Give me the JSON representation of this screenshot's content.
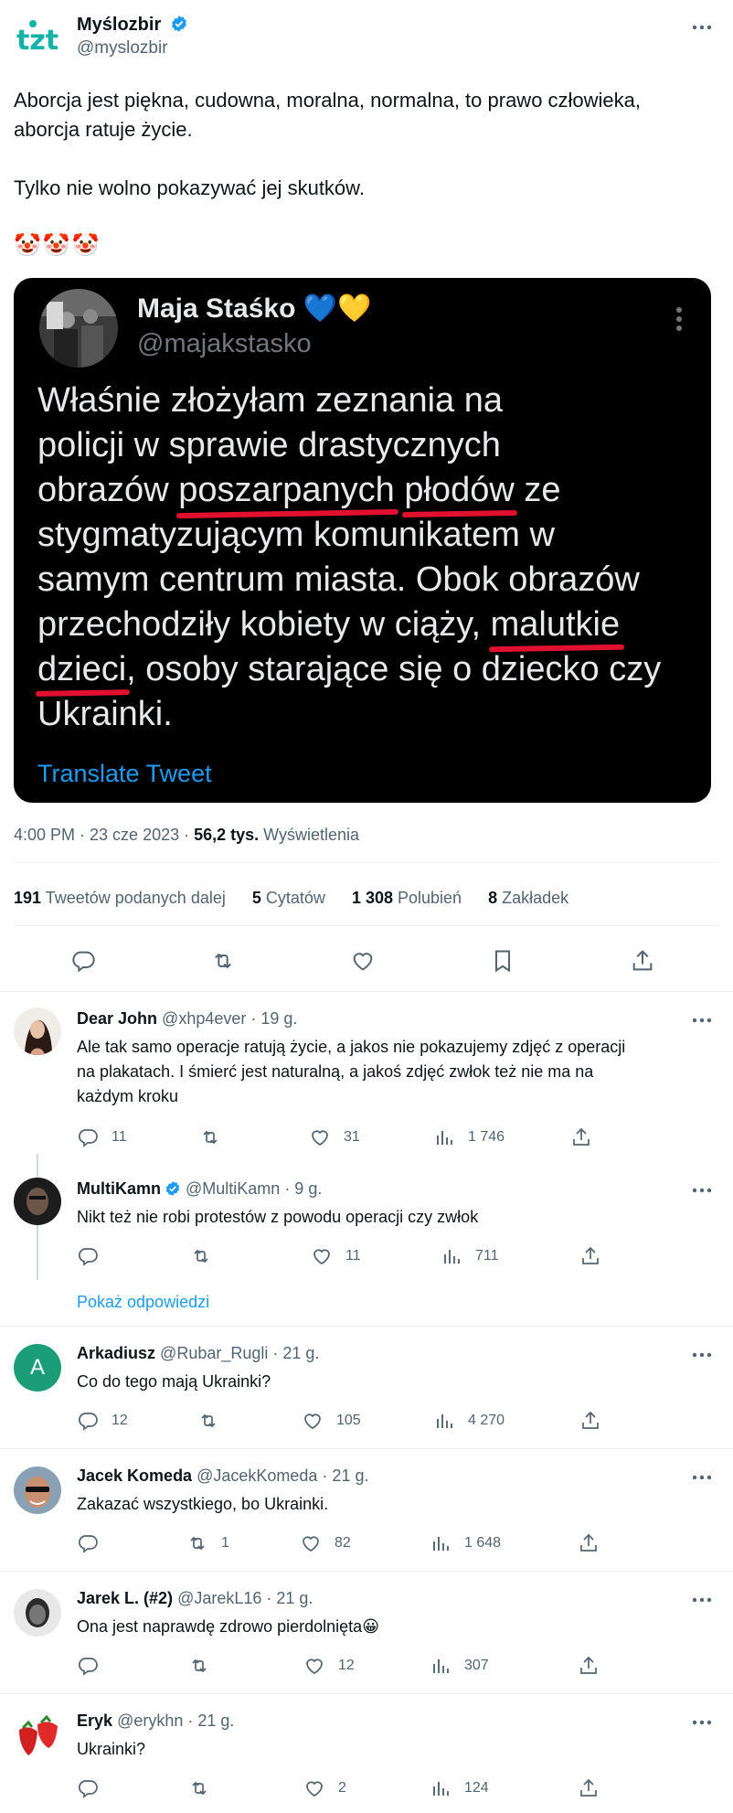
{
  "main_tweet": {
    "author_name": "Myślozbir",
    "handle": "@myslozbir",
    "logo_text": "tzt",
    "text_lines": [
      "Aborcja jest piękna, cudowna, moralna, normalna, to prawo człowieka,",
      "aborcja ratuje życie."
    ],
    "text_line2": "Tylko nie wolno pokazywać jej skutków.",
    "emoji": "🤡🤡🤡",
    "quoted": {
      "name": "Maja Staśko",
      "name_emoji": "💙💛",
      "handle": "@majakstasko",
      "body_lines": [
        [
          "Właśnie złożyłam zeznania na"
        ],
        [
          "policji w sprawie drastycznych"
        ],
        [
          "obrazów ",
          "poszarpanych",
          " ",
          "płodów",
          " ze"
        ],
        [
          "stygmatyzującym komunikatem w"
        ],
        [
          "samym centrum miasta. Obok obrazów"
        ],
        [
          "przechodziły kobiety w ciąży, ",
          "malutkie"
        ],
        [
          "dzieci",
          ", osoby starające się o dziecko czy"
        ],
        [
          "Ukrainki."
        ]
      ],
      "translate": "Translate Tweet"
    },
    "time": "4:00 PM · 23 cze 2023 · ",
    "views_count": "56,2 tys.",
    "views_label": " Wyświetlenia",
    "stats": {
      "retweets_count": "191",
      "retweets_label": " Tweetów podanych dalej",
      "quotes_count": "5",
      "quotes_label": " Cytatów",
      "likes_count": "1 308",
      "likes_label": " Polubień",
      "bookmarks_count": "8",
      "bookmarks_label": " Zakładek"
    }
  },
  "replies": [
    {
      "name": "Dear John",
      "handle": "@xhp4ever · 19 g.",
      "lines": [
        "Ale tak samo operacje ratują życie, a jakos nie pokazujemy zdjęć z operacji",
        "na plakatach. I śmierć jest naturalną, a jakoś zdjęć zwłok też nie ma na",
        "każdym kroku"
      ],
      "replies": "11",
      "retweets": "",
      "likes": "31",
      "views": "1 746"
    },
    {
      "name": "MultiKamn",
      "handle": "@MultiKamn · 9 g.",
      "lines": [
        "Nikt też nie robi protestów z powodu operacji czy zwłok"
      ],
      "replies": "",
      "retweets": "",
      "likes": "11",
      "views": "711"
    },
    {
      "name": "Arkadiusz",
      "handle": "@Rubar_Rugli · 21 g.",
      "avatar_letter": "A",
      "lines": [
        "Co do tego mają Ukrainki?"
      ],
      "replies": "12",
      "retweets": "",
      "likes": "105",
      "views": "4 270"
    },
    {
      "name": "Jacek Komeda",
      "handle": "@JacekKomeda · 21 g.",
      "lines": [
        "Zakazać wszystkiego, bo Ukrainki."
      ],
      "replies": "",
      "retweets": "1",
      "likes": "82",
      "views": "1 648"
    },
    {
      "name": "Jarek L. (#2)",
      "handle": "@JarekL16 · 21 g.",
      "lines": [
        "Ona jest naprawdę zdrowo pierdolnięta😀"
      ],
      "replies": "",
      "retweets": "",
      "likes": "12",
      "views": "307"
    },
    {
      "name": "Eryk",
      "handle": "@erykhn · 21 g.",
      "lines": [
        "Ukrainki?"
      ],
      "replies": "",
      "retweets": "",
      "likes": "2",
      "views": "124"
    }
  ],
  "show_replies": "Pokaż odpowiedzi",
  "colors": {
    "accent": "#1d9bf0",
    "muted": "#536471",
    "underline": "#e0102e"
  }
}
